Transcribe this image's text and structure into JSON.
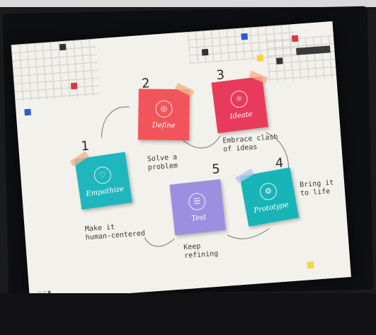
{
  "toolbar": {
    "label": ""
  },
  "steps": [
    {
      "number": "1",
      "title": "Empathize",
      "caption": "Make it\nhuman-centered",
      "color": "#1fb6bd"
    },
    {
      "number": "2",
      "title": "Define",
      "caption": "Solve a\nproblem",
      "color": "#f2545b"
    },
    {
      "number": "3",
      "title": "Ideate",
      "caption": "Embrace clash\nof ideas",
      "color": "#e83b5b"
    },
    {
      "number": "4",
      "title": "Prototype",
      "caption": "Bring it\nto life",
      "color": "#18b5b8"
    },
    {
      "number": "5",
      "title": "Test",
      "caption": "Keep\nrefining",
      "color": "#9d8fe0"
    }
  ],
  "accent_colors": {
    "blue": "#2b5bd1",
    "red": "#e0353c",
    "yellow": "#f2d437",
    "dark": "#333333"
  }
}
